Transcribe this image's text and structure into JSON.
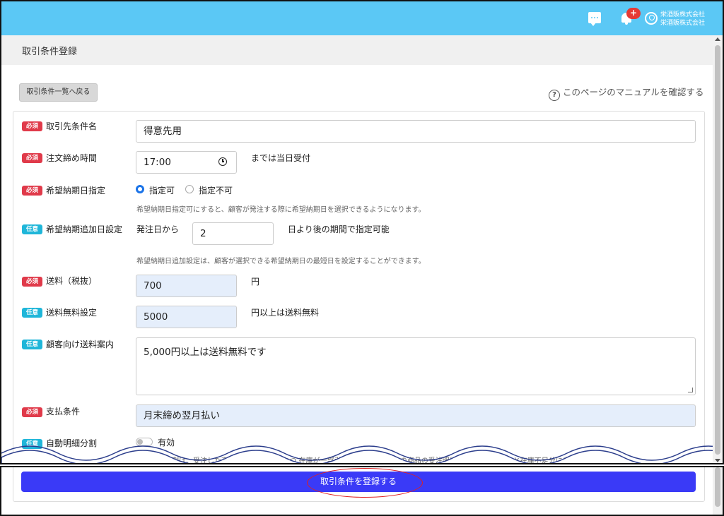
{
  "header": {
    "notification_badge": "+",
    "user_line1": "栄酒販株式会社",
    "user_line2": "栄酒販株式会社",
    "accent_color": "#5bc8f5"
  },
  "page": {
    "title": "取引条件登録",
    "back_button": "取引条件一覧へ戻る",
    "manual_link": "このページのマニュアルを確認する"
  },
  "tags": {
    "required": "必須",
    "optional": "任意"
  },
  "form": {
    "partner_name": {
      "label": "取引先条件名",
      "value": "得意先用"
    },
    "cutoff_time": {
      "label": "注文締め時間",
      "value": "17:00",
      "suffix": "までは当日受付"
    },
    "delivery_date": {
      "label": "希望納期日指定",
      "option_yes": "指定可",
      "option_no": "指定不可",
      "selected": "指定可",
      "note": "希望納期日指定可にすると、顧客が発注する際に希望納期日を選択できるようになります。"
    },
    "delivery_add_days": {
      "label": "希望納期追加日設定",
      "prefix": "発注日から",
      "value": "2",
      "suffix": "日より後の期間で指定可能",
      "note": "希望納期日追加設定は、顧客が選択できる希望納期日の最短日を設定することができます。"
    },
    "shipping_fee": {
      "label": "送料（税抜）",
      "value": "700",
      "suffix": "円"
    },
    "free_shipping": {
      "label": "送料無料設定",
      "value": "5000",
      "suffix": "円以上は送料無料"
    },
    "shipping_guide": {
      "label": "顧客向け送料案内",
      "value": "5,000円以上は送料無料です"
    },
    "payment_terms": {
      "label": "支払条件",
      "value": "月末締め翌月払い"
    },
    "auto_split": {
      "label": "自動明細分割",
      "toggle_label": "有効",
      "enabled": false,
      "note": "自動明細分割は、受注した商品が 予約販売可 かつ 在庫が一部引当可能 の場合、その商品の受注明細を在庫引当可能分と在庫不足分に自動で分割します。"
    }
  },
  "submit_button": "取引条件を登録する"
}
